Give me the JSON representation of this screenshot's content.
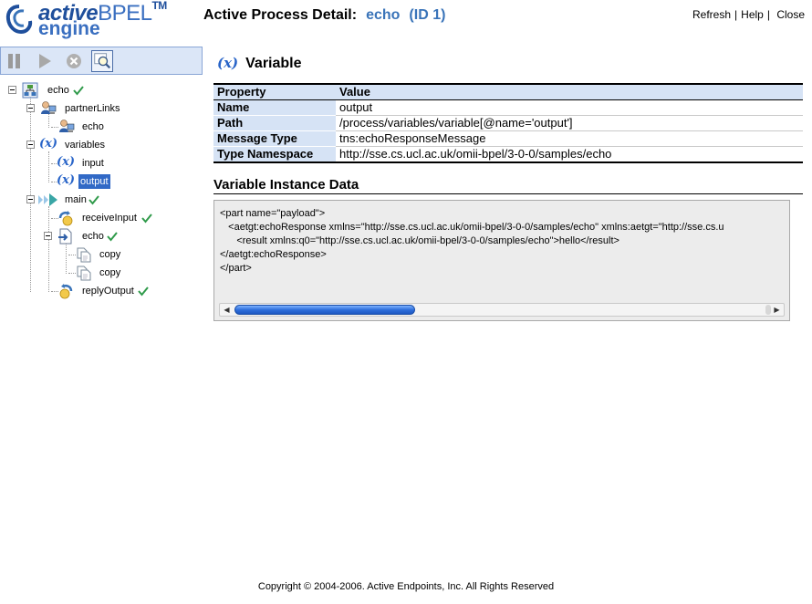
{
  "brand": {
    "name_prefix": "active",
    "name_bpel": "BPEL",
    "trademark": "TM",
    "name_line2": "engine",
    "colors": {
      "primary": "#1f4f9c",
      "accent": "#3a74b9"
    }
  },
  "header": {
    "title": "Active Process Detail:",
    "process_name": "echo",
    "process_id": "(ID 1)",
    "links": {
      "refresh": "Refresh",
      "help": "Help",
      "close": "Close"
    }
  },
  "toolbar": {
    "buttons": [
      "pause-icon",
      "play-icon",
      "stop-icon",
      "find-icon"
    ]
  },
  "tree": {
    "root": "echo",
    "partner_links": "partnerLinks",
    "partner_echo": "echo",
    "variables": "variables",
    "var_input": "input",
    "var_output": "output",
    "main": "main",
    "receive": "receiveInput",
    "echo_assign": "echo",
    "copy1": "copy",
    "copy2": "copy",
    "reply": "replyOutput",
    "selected": "output"
  },
  "variable": {
    "section_icon": "(x)",
    "section_title": "Variable",
    "columns": {
      "property": "Property",
      "value": "Value"
    },
    "rows": [
      {
        "key": "Name",
        "value": "output"
      },
      {
        "key": "Path",
        "value": "/process/variables/variable[@name='output']"
      },
      {
        "key": "Message Type",
        "value": "tns:echoResponseMessage"
      },
      {
        "key": "Type Namespace",
        "value": "http://sse.cs.ucl.ac.uk/omii-bpel/3-0-0/samples/echo"
      }
    ]
  },
  "instance": {
    "title": "Variable Instance Data",
    "xml_lines": [
      "<part name=\"payload\">",
      "   <aetgt:echoResponse xmlns=\"http://sse.cs.ucl.ac.uk/omii-bpel/3-0-0/samples/echo\" xmlns:aetgt=\"http://sse.cs.u",
      "      <result xmlns:q0=\"http://sse.cs.ucl.ac.uk/omii-bpel/3-0-0/samples/echo\">hello</result>",
      "</aetgt:echoResponse>",
      "</part>"
    ]
  },
  "footer": {
    "copyright": "Copyright © 2004-2006. Active Endpoints, Inc. All Rights Reserved"
  }
}
